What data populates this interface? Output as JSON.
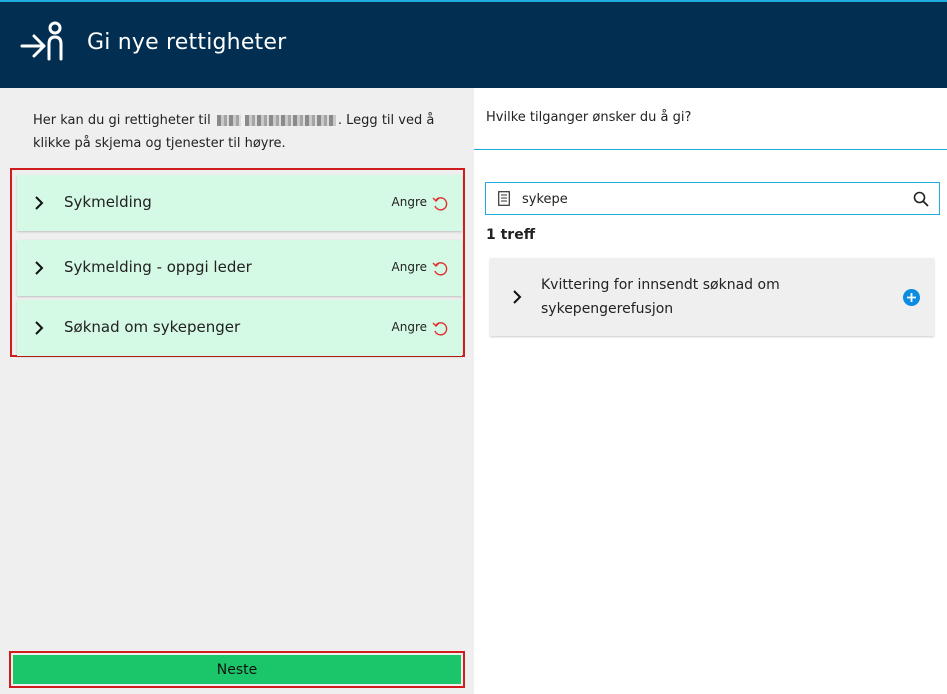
{
  "header": {
    "title": "Gi nye rettigheter",
    "icon": "person-arrow-icon",
    "background": "#022f51"
  },
  "left": {
    "intro_before": "Her kan du gi rettigheter til",
    "intro_after": ". Legg til ved å klikke på skjema og tjenester til høyre.",
    "items": [
      {
        "label": "Sykmelding",
        "undo_label": "Angre"
      },
      {
        "label": "Sykmelding - oppgi leder",
        "undo_label": "Angre"
      },
      {
        "label": "Søknad om sykepenger",
        "undo_label": "Angre"
      }
    ],
    "next_label": "Neste",
    "item_color": "#d4f9e4",
    "next_color": "#1bc569"
  },
  "right": {
    "title": "Hvilke tilganger ønsker du å gi?",
    "search_value": "sykepe",
    "result_count": "1 treff",
    "results": [
      {
        "label": "Kvittering for innsendt søknad om sykepengerefusjon"
      }
    ],
    "accent": "#1eaddc"
  }
}
